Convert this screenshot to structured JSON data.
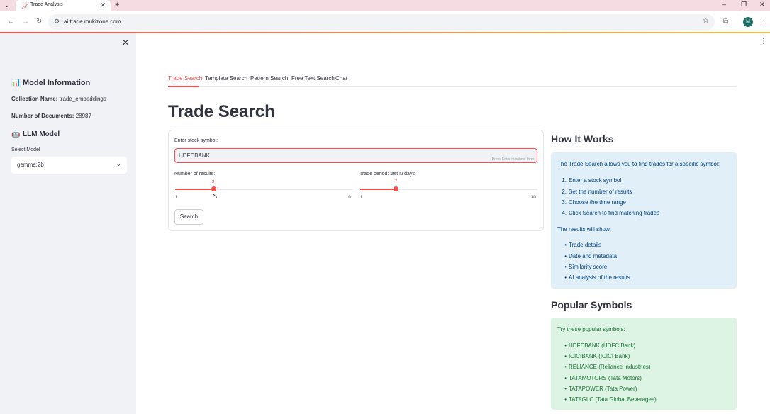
{
  "browser": {
    "tab_title": "Trade Analysis",
    "url": "ai.trade.mukizone.com",
    "profile_initial": "M"
  },
  "sidebar": {
    "model_info_heading": "Model Information",
    "collection_label": "Collection Name:",
    "collection_value": "trade_embeddings",
    "documents_label": "Number of Documents:",
    "documents_value": "28987",
    "llm_heading": "LLM Model",
    "select_label": "Select Model",
    "select_value": "gemma:2b"
  },
  "tabs": [
    "Trade Search",
    "Template Search",
    "Pattern Search",
    "Free Text Search",
    "Chat"
  ],
  "main": {
    "title": "Trade Search",
    "symbol_label": "Enter stock symbol:",
    "symbol_value": "HDFCBANK",
    "symbol_hint": "Press Enter to submit form",
    "results_slider": {
      "label": "Number of results:",
      "value": "3",
      "min": "1",
      "max": "10"
    },
    "period_slider": {
      "label": "Trade period: last N days",
      "value": "7",
      "min": "1",
      "max": "30"
    },
    "search_button": "Search"
  },
  "how_it_works": {
    "heading": "How It Works",
    "intro": "The Trade Search allows you to find trades for a specific symbol:",
    "steps": [
      "Enter a stock symbol",
      "Set the number of results",
      "Choose the time range",
      "Click Search to find matching trades"
    ],
    "results_intro": "The results will show:",
    "results": [
      "Trade details",
      "Date and metadata",
      "Similarity score",
      "AI analysis of the results"
    ]
  },
  "popular": {
    "heading": "Popular Symbols",
    "intro": "Try these popular symbols:",
    "items": [
      "HDFCBANK (HDFC Bank)",
      "ICICIBANK (ICICI Bank)",
      "RELIANCE (Reliance Industries)",
      "TATAMOTORS (Tata Motors)",
      "TATAPOWER (Tata Power)",
      "TATAGLC (Tata Global Beverages)"
    ]
  },
  "colors": {
    "accent": "#ff4b4b",
    "sidebar_bg": "#f0f2f6",
    "info_bg": "#e1eff8",
    "success_bg": "#ddf3e4"
  }
}
